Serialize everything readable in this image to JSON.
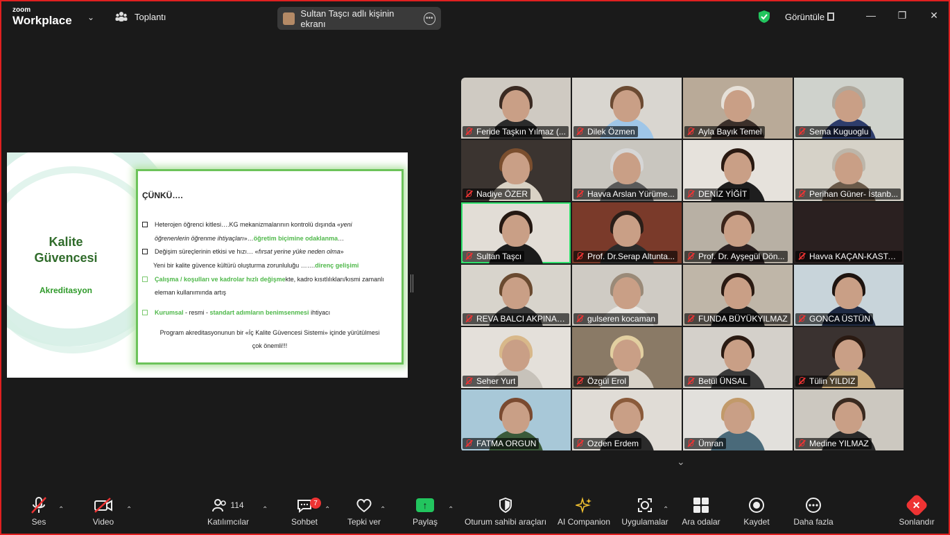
{
  "app": {
    "brand_small": "zoom",
    "brand_big": "Workplace",
    "meeting_label": "Toplantı"
  },
  "share_banner": {
    "text": "Sultan Taşcı adlı kişinin ekranı"
  },
  "header_right": {
    "view_label": "Görüntüle"
  },
  "slide": {
    "title": "Kalite Güvencesi",
    "subtitle": "Akreditasyon",
    "heading": "ÇÜNKÜ….",
    "l1a": "Heterojen öğrenci kitlesi….KG mekanizmalarının kontrolü dışında «",
    "l1b": "yeni",
    "l2a": "öğrenenlerin öğrenme ihtiyaçları",
    "l2b": "»…",
    "l2c": "öğretim biçimine odaklanma",
    "l2d": "…",
    "l3a": "Değişim süreçlerinin etkisi ve hızı… «",
    "l3b": "fırsat yerine yüke neden olma",
    "l3c": "»",
    "l4a": "Yeni bir kalite güvence kültürü oluşturma zorunluluğu …….",
    "l4b": "direnç gelişimi",
    "l5a": "Çalışma / koşulları ve kadrolar hızlı değişme",
    "l5b": "kte, kadro kısıtlılıkları/kısmi zamanlı",
    "l6": "eleman kullanımında artış",
    "l7a": "Kurumsal",
    "l7b": " - resmi - ",
    "l7c": "standart adımların benimsenmesi",
    "l7d": " ihtiyacı",
    "l8a": "Program akreditasyonunun bir «",
    "l8b": "İç Kalite Güvencesi Sistemi",
    "l8c": "» içinde yürütülmesi",
    "l9": "çok önemli!!!"
  },
  "participants": [
    {
      "name": "Feride Taşkın Yılmaz (...",
      "bg": "#cfcac2",
      "shirt": "#2b2b2b",
      "hair": "#3a2a22"
    },
    {
      "name": "Dilek Özmen",
      "bg": "#d9d6d0",
      "shirt": "#9fc6e8",
      "hair": "#6b4a32"
    },
    {
      "name": "Ayla Bayık Temel",
      "bg": "#b9aa98",
      "shirt": "#3b2f2a",
      "hair": "#e6e0d8"
    },
    {
      "name": "Sema Kuguoglu",
      "bg": "#cfd2cc",
      "shirt": "#2d3c6b",
      "hair": "#b0a89c"
    },
    {
      "name": "Nadiye ÖZER",
      "bg": "#3b3430",
      "shirt": "#d9d2c5",
      "hair": "#7a4e2e"
    },
    {
      "name": "Havva Arslan Yürüme...",
      "bg": "#c9c6bf",
      "shirt": "#5a5a5a",
      "hair": "#d6d6d6"
    },
    {
      "name": "DENİZ YİĞİT",
      "bg": "#e6e2dc",
      "shirt": "#1e1e1e",
      "hair": "#2a1a12"
    },
    {
      "name": "Perihan Güner- İstanb...",
      "bg": "#d6d2c8",
      "shirt": "#6a5a4a",
      "hair": "#bdb6aa"
    },
    {
      "name": "Sultan Taşcı",
      "bg": "#e2ddd6",
      "shirt": "#1b1b1b",
      "hair": "#241812"
    },
    {
      "name": "Prof. Dr.Serap Altunta...",
      "bg": "#7a3a2a",
      "shirt": "#2a2a2a",
      "hair": "#2a1e18"
    },
    {
      "name": "Prof. Dr. Ayşegül Dön...",
      "bg": "#b8b0a4",
      "shirt": "#2a2020",
      "hair": "#3a241a"
    },
    {
      "name": "Havva KAÇAN-KASTA...",
      "bg": "#2a2020",
      "shirt": "#2a2020",
      "hair": "#2a2020"
    },
    {
      "name": "REVA BALCI AKPINAR ...",
      "bg": "#d8d4cc",
      "shirt": "#3a3a3a",
      "hair": "#6a4a30"
    },
    {
      "name": "gulseren kocaman",
      "bg": "#cfcbc4",
      "shirt": "#e8e6e2",
      "hair": "#9a8a78"
    },
    {
      "name": "FUNDA BÜYÜKYILMAZ",
      "bg": "#bfb6a8",
      "shirt": "#1e1e1e",
      "hair": "#2a1a12"
    },
    {
      "name": "GONCA ÜSTÜN",
      "bg": "#c8d4da",
      "shirt": "#1e2a44",
      "hair": "#1e1410"
    },
    {
      "name": "Seher Yurt",
      "bg": "#e4e0da",
      "shirt": "#c7c2ba",
      "hair": "#d8b88a"
    },
    {
      "name": "Özgül Erol",
      "bg": "#8a7a66",
      "shirt": "#d8d2c8",
      "hair": "#e2cfa0"
    },
    {
      "name": "Betül ÜNSAL",
      "bg": "#d4d0ca",
      "shirt": "#3a3a3a",
      "hair": "#2a1a12"
    },
    {
      "name": "Tülin YILDIZ",
      "bg": "#3a3230",
      "shirt": "#c8a878",
      "hair": "#2a1a12"
    },
    {
      "name": "FATMA ORGUN",
      "bg": "#a8c8d8",
      "shirt": "#3a5a3a",
      "hair": "#7a4a30"
    },
    {
      "name": "Ozden Erdem",
      "bg": "#e0dcd6",
      "shirt": "#2a2a2a",
      "hair": "#8a5a3a"
    },
    {
      "name": "Ümran",
      "bg": "#e2e0dc",
      "shirt": "#4a6a7a",
      "hair": "#c29a6a"
    },
    {
      "name": "Medine YILMAZ",
      "bg": "#ccc8c0",
      "shirt": "#2a2a2a",
      "hair": "#3a2a20"
    }
  ],
  "toolbar": {
    "audio": "Ses",
    "video": "Video",
    "participants": "Katılımcılar",
    "participants_count": "114",
    "chat": "Sohbet",
    "chat_badge": "7",
    "react": "Tepki ver",
    "share": "Paylaş",
    "host_tools": "Oturum sahibi araçları",
    "ai": "AI Companion",
    "apps": "Uygulamalar",
    "breakout": "Ara odalar",
    "record": "Kaydet",
    "more": "Daha fazla",
    "end": "Sonlandır"
  },
  "colors": {
    "accent_green": "#2ee06b",
    "end_red": "#e33333",
    "share_green": "#22c55e"
  }
}
